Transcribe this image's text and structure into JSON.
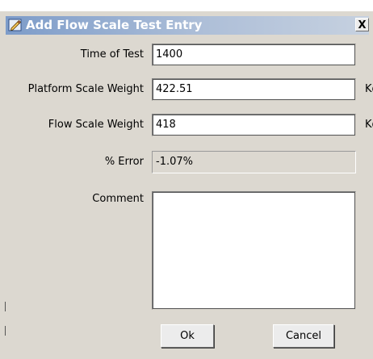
{
  "dialog": {
    "title": "Add Flow Scale Test Entry",
    "close_label": "X",
    "colors": {
      "title_gradient_start": "#7d9cc9",
      "title_gradient_end": "#c6d1e0",
      "background": "#dcd8d0"
    }
  },
  "fields": {
    "time_of_test": {
      "label": "Time of Test",
      "value": "1400"
    },
    "platform_scale_weight": {
      "label": "Platform Scale Weight",
      "value": "422.51",
      "unit": "Kg"
    },
    "flow_scale_weight": {
      "label": "Flow Scale Weight",
      "value": "418",
      "unit": "Kg"
    },
    "percent_error": {
      "label": "% Error",
      "value": "-1.07%"
    },
    "comment": {
      "label": "Comment",
      "value": ""
    }
  },
  "buttons": {
    "ok_label": "Ok",
    "cancel_label": "Cancel"
  },
  "icons": {
    "title_icon": "edit-pencil-icon",
    "close_icon": "close-icon"
  }
}
